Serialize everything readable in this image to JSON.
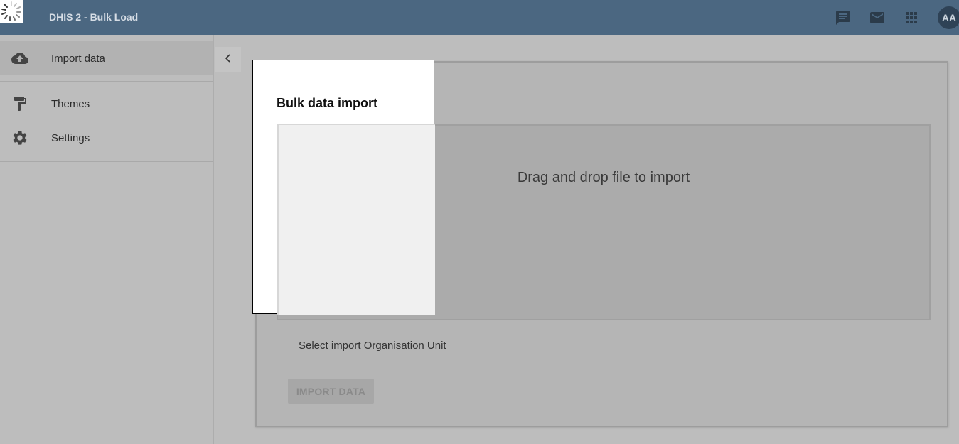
{
  "header": {
    "title": "DHIS 2 - Bulk Load",
    "icons": [
      "message-icon",
      "mail-icon",
      "apps-icon"
    ],
    "avatar_initials": "AA",
    "color": "#4b6781"
  },
  "sidebar": {
    "items": [
      {
        "label": "Import data",
        "icon": "cloud-upload-icon",
        "active": true
      },
      {
        "label": "Themes",
        "icon": "paint-roller-icon",
        "active": false
      },
      {
        "label": "Settings",
        "icon": "gear-icon",
        "active": false
      }
    ]
  },
  "main": {
    "title": "Bulk data import",
    "dropzone_text": "Drag and drop file to import",
    "orgunit_label": "Select import Organisation Unit",
    "import_button": "IMPORT DATA"
  }
}
